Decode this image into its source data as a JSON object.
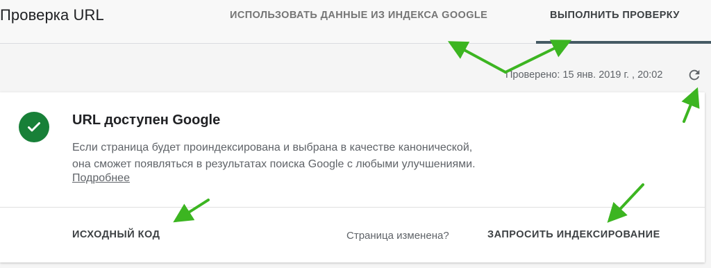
{
  "header": {
    "title": "Проверка URL",
    "tabs": [
      {
        "label": "ИСПОЛЬЗОВАТЬ ДАННЫЕ ИЗ ИНДЕКСА GOOGLE",
        "active": false
      },
      {
        "label": "ВЫПОЛНИТЬ ПРОВЕРКУ",
        "active": true
      }
    ]
  },
  "status": {
    "checked_label": "Проверено: 15 янв. 2019 г. , 20:02",
    "refresh_icon": "refresh-icon"
  },
  "card": {
    "status_icon": "check-circle-icon",
    "title": "URL доступен Google",
    "description_line1": "Если страница будет проиндексирована и выбрана в качестве канонической,",
    "description_line2": "она сможет появляться в результатах поиска Google с любыми улучшениями.",
    "more_link": "Подробнее",
    "actions": {
      "source_code": "ИСХОДНЫЙ КОД",
      "page_changed_question": "Страница изменена?",
      "request_indexing": "ЗАПРОСИТЬ ИНДЕКСИРОВАНИЕ"
    }
  },
  "colors": {
    "accent_green": "#188038",
    "tab_underline": "#455a64",
    "annotation_arrow": "#3cb521"
  }
}
